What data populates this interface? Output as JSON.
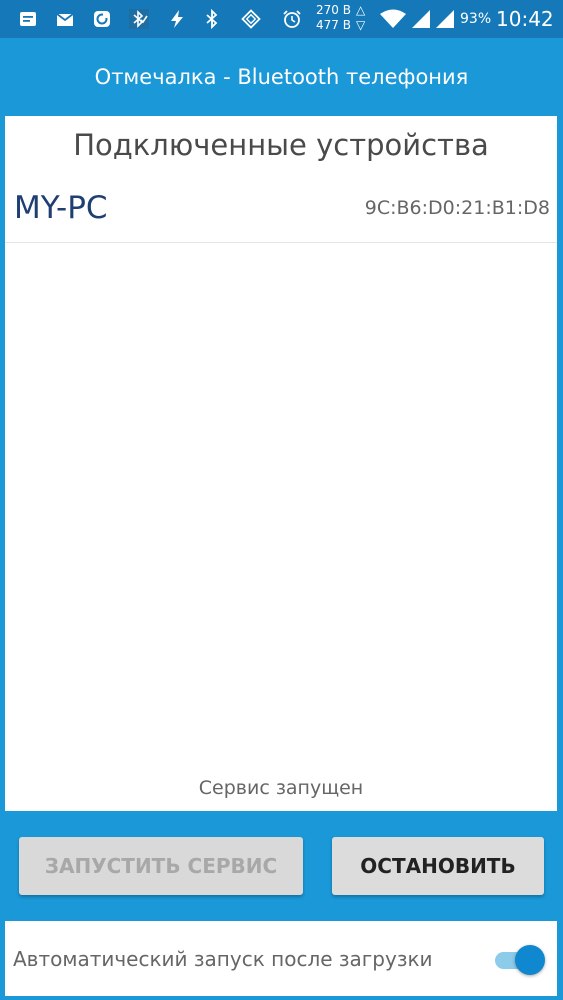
{
  "status_bar": {
    "icons": [
      "notes-icon",
      "mail-icon",
      "sync-icon",
      "bluetooth-check-icon",
      "flash-icon",
      "bluetooth-icon",
      "rotate-icon",
      "alarm-icon",
      "wifi-icon",
      "signal-icon",
      "signal-icon-2"
    ],
    "upload_speed": "270 B",
    "download_speed": "477 B",
    "battery": "93%",
    "time": "10:42"
  },
  "app": {
    "title": "Отмечалка - Bluetooth телефония"
  },
  "main": {
    "heading": "Подключенные устройства",
    "devices": [
      {
        "name": "MY-PC",
        "address": "9C:B6:D0:21:B1:D8"
      }
    ],
    "service_status": "Сервис запущен"
  },
  "buttons": {
    "start_label": "ЗАПУСТИТЬ СЕРВИС",
    "stop_label": "ОСТАНОВИТЬ"
  },
  "autostart": {
    "label": "Автоматический запуск после загрузки",
    "enabled": true
  },
  "colors": {
    "background": "#1a98d8",
    "status_bar": "#1478b9",
    "device_name": "#1f3f73",
    "toggle_on": "#0f88d0"
  }
}
